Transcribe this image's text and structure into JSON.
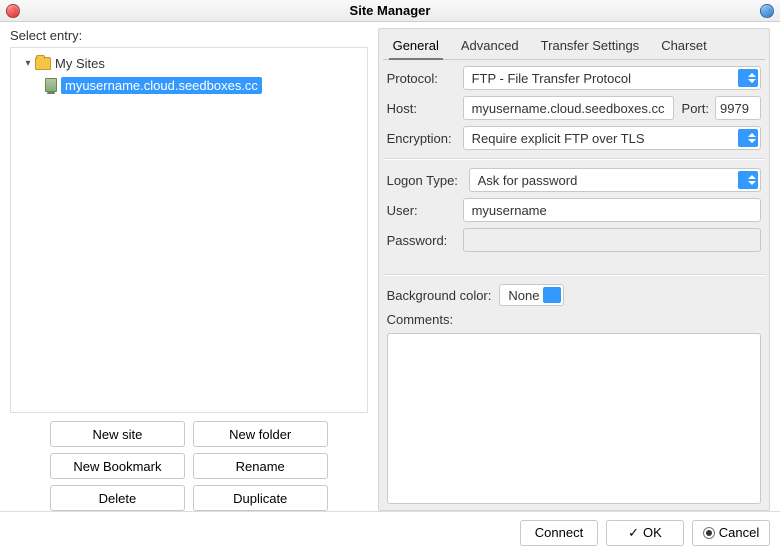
{
  "window": {
    "title": "Site Manager"
  },
  "left": {
    "select_entry_label": "Select entry:",
    "tree": {
      "root_label": "My Sites",
      "selected_site": "myusername.cloud.seedboxes.cc"
    },
    "buttons": {
      "new_site": "New site",
      "new_folder": "New folder",
      "new_bookmark": "New Bookmark",
      "rename": "Rename",
      "delete": "Delete",
      "duplicate": "Duplicate"
    }
  },
  "tabs": {
    "general": "General",
    "advanced": "Advanced",
    "transfer": "Transfer Settings",
    "charset": "Charset"
  },
  "form": {
    "protocol_label": "Protocol:",
    "protocol_value": "FTP - File Transfer Protocol",
    "host_label": "Host:",
    "host_value": "myusername.cloud.seedboxes.cc",
    "port_label": "Port:",
    "port_value": "9979",
    "encryption_label": "Encryption:",
    "encryption_value": "Require explicit FTP over TLS",
    "logon_type_label": "Logon Type:",
    "logon_type_value": "Ask for password",
    "user_label": "User:",
    "user_value": "myusername",
    "password_label": "Password:",
    "password_value": "",
    "bgcolor_label": "Background color:",
    "bgcolor_value": "None",
    "comments_label": "Comments:"
  },
  "footer": {
    "connect": "Connect",
    "ok": "OK",
    "cancel": "Cancel"
  }
}
